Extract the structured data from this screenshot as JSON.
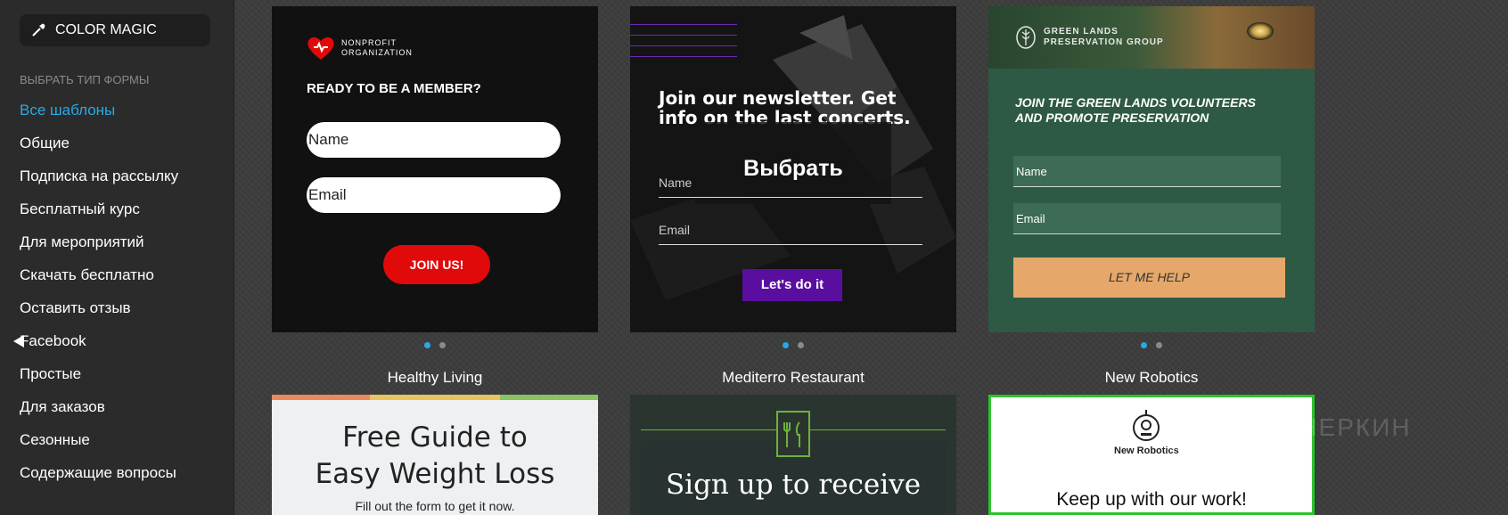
{
  "sidebar": {
    "color_magic": "COLOR MAGIC",
    "section_label": "ВЫБРАТЬ ТИП ФОРМЫ",
    "items": [
      {
        "label": "Все шаблоны"
      },
      {
        "label": "Общие"
      },
      {
        "label": "Подписка на рассылку"
      },
      {
        "label": "Бесплатный курс"
      },
      {
        "label": "Для мероприятий"
      },
      {
        "label": "Скачать бесплатно"
      },
      {
        "label": "Оставить отзыв"
      },
      {
        "label": "Facebook"
      },
      {
        "label": "Простые"
      },
      {
        "label": "Для заказов"
      },
      {
        "label": "Сезонные"
      },
      {
        "label": "Содержащие вопросы"
      }
    ],
    "active_index": 0
  },
  "templates": {
    "nonprofit": {
      "logo_line1": "NONPROFIT",
      "logo_line2": "ORGANIZATION",
      "headline": "READY TO BE A MEMBER?",
      "name_placeholder": "Name",
      "email_placeholder": "Email",
      "button": "JOIN US!"
    },
    "newsletter": {
      "headline": "Join our newsletter. Get info on the last concerts.",
      "hover_action": "Выбрать",
      "name_placeholder": "Name",
      "email_placeholder": "Email",
      "button": "Let's do it"
    },
    "greenlands": {
      "brand_line1": "GREEN LANDS",
      "brand_line2": "PRESERVATION GROUP",
      "headline_line1": "JOIN THE GREEN LANDS VOLUNTEERS",
      "headline_line2": "AND PROMOTE PRESERVATION",
      "name_placeholder": "Name",
      "email_placeholder": "Email",
      "button": "LET ME HELP"
    },
    "healthy": {
      "title": "Healthy Living",
      "headline_line1": "Free Guide to",
      "headline_line2": "Easy Weight Loss",
      "sub": "Fill out the form to get it now."
    },
    "mediterro": {
      "title": "Mediterro Restaurant",
      "headline": "Sign up to receive"
    },
    "robotics": {
      "title": "New Robotics",
      "brand": "New Robotics",
      "headline": "Keep up with our work!"
    }
  },
  "watermark": "ПАРТНЕРКИН",
  "colors": {
    "accent": "#29a9e6",
    "red_button": "#e10a0a",
    "purple_button": "#5a0ea0",
    "green_card": "#2e5a45",
    "orange_button": "#e6a86a",
    "robotics_border": "#2bc42b"
  }
}
